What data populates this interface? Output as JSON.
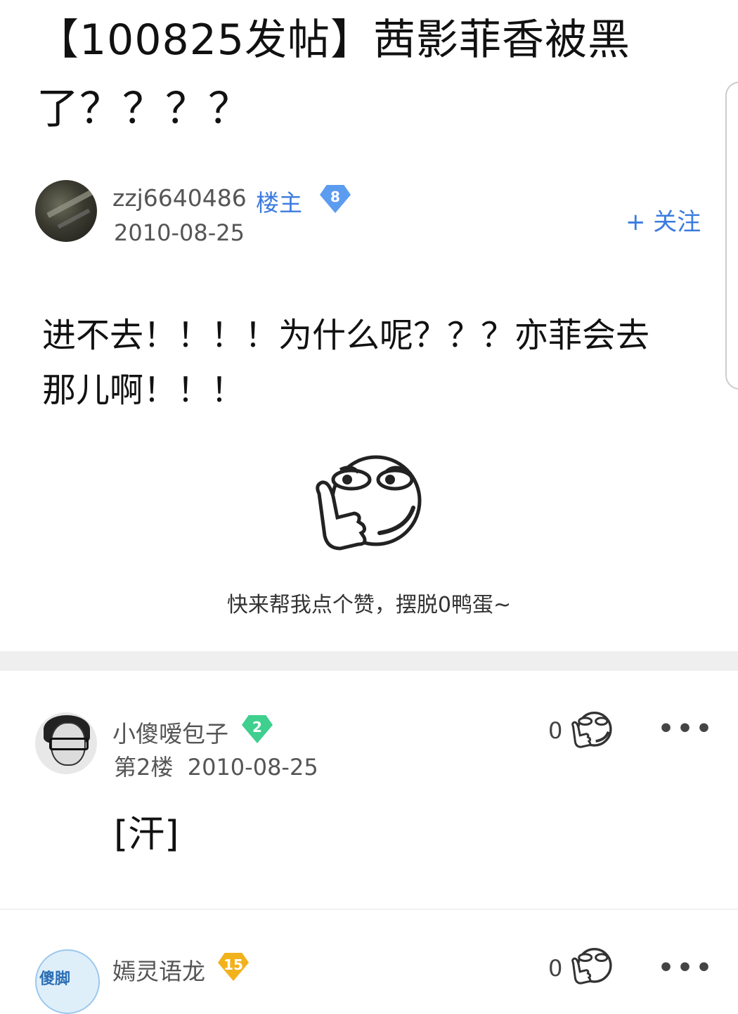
{
  "post": {
    "title": "【100825发帖】茜影菲香被黑了？？？？",
    "author": {
      "name": "zzj6640486",
      "badge": "楼主",
      "level": "8",
      "date": "2010-08-25"
    },
    "follow_label": "+ 关注",
    "body": "进不去！！！！为什么呢？？？亦菲会去那儿啊！！！",
    "like_prompt": "快来帮我点个赞，摆脱0鸭蛋~"
  },
  "replies": [
    {
      "name": "小傻嗳包子",
      "level": "2",
      "floor": "第2楼",
      "date": "2010-08-25",
      "content": "[汗]",
      "likes": "0",
      "more": "•••"
    },
    {
      "name": "嫣灵语龙",
      "level": "15",
      "likes": "0",
      "more": "•••",
      "avatar_text": "傻脚"
    }
  ],
  "colors": {
    "accent_blue": "#3b7be0",
    "level_blue": "#5b9cf0",
    "level_green": "#3fcf8e",
    "level_gold": "#f1b21b"
  }
}
